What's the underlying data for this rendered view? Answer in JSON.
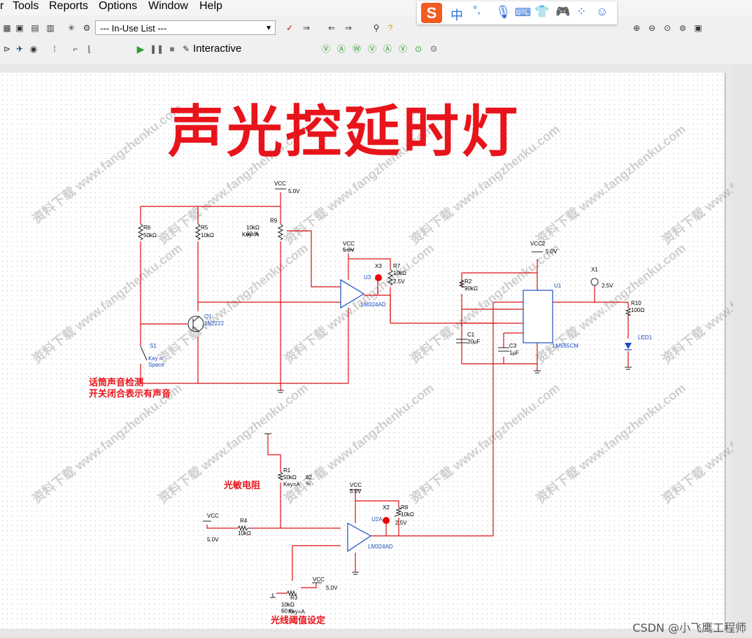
{
  "menu": {
    "items": [
      "r",
      "Tools",
      "Reports",
      "Options",
      "Window",
      "Help"
    ]
  },
  "toolbar": {
    "inuse_list": "--- In-Use List ---",
    "interactive_label": "Interactive"
  },
  "ime": {
    "glyphs": [
      "S",
      "中",
      "°,"
    ]
  },
  "schematic": {
    "title": "声光控延时灯",
    "annotations": {
      "mic_line1": "话筒声音检测",
      "mic_line2": "开关闭合表示有声音",
      "ldr": "光敏电阻",
      "threshold": "光线阈值设定"
    },
    "components": {
      "vcc_top": "VCC",
      "vcc_top_v": "5.0V",
      "r6": "R6",
      "r6_v": "50kΩ",
      "r5": "R5",
      "r5_v": "10kΩ",
      "r9": "R9",
      "r9_v": "10kΩ  60 %",
      "r9_key": "Key=A",
      "vcc2_op": "VCC  5.0V",
      "x3": "X3",
      "r7": "R7",
      "r7_v": "10kΩ",
      "x3_v": "2.5V",
      "u3": "U3",
      "lm324_1": "LM324AD",
      "q1": "Q1",
      "q1_v": "2N2222",
      "s1": "S1",
      "s1_key": "Key = Space",
      "vcc2": "VCC2",
      "vcc2_v": "5.0V",
      "r2": "R2",
      "r2_v": "90kΩ",
      "c1": "C1",
      "c1_v": "20µF",
      "c3": "C3",
      "c3_v": "1µF",
      "u1": "U1",
      "u1_v": "LM555CM",
      "x1": "X1",
      "x1_v": "2.5V",
      "r10": "R10",
      "r10_v": "100Ω",
      "led1": "LED1",
      "r1": "R1",
      "r1_v": "50kΩ",
      "r1_pct": "82 %",
      "r1_key": "Key=A",
      "vcc_b": "VCC",
      "vcc_b_v": "5.0V",
      "r4": "R4",
      "r4_v": "10kΩ",
      "vcc_op2": "VCC  5.0V",
      "x2": "X2",
      "r8": "R8",
      "r8_v": "10kΩ",
      "x2_v": "2.5V",
      "u2": "U2A",
      "lm324_2": "LM324AD",
      "vcc_r3": "VCC",
      "vcc_r3_v": "5.0V",
      "r3": "R3",
      "r3_v": "10kΩ  60 %",
      "r3_key": "Key=A"
    },
    "watermark": "资料下载 www.fangzhenku.com"
  },
  "footer": {
    "credit": "CSDN @小飞鹰工程师"
  }
}
